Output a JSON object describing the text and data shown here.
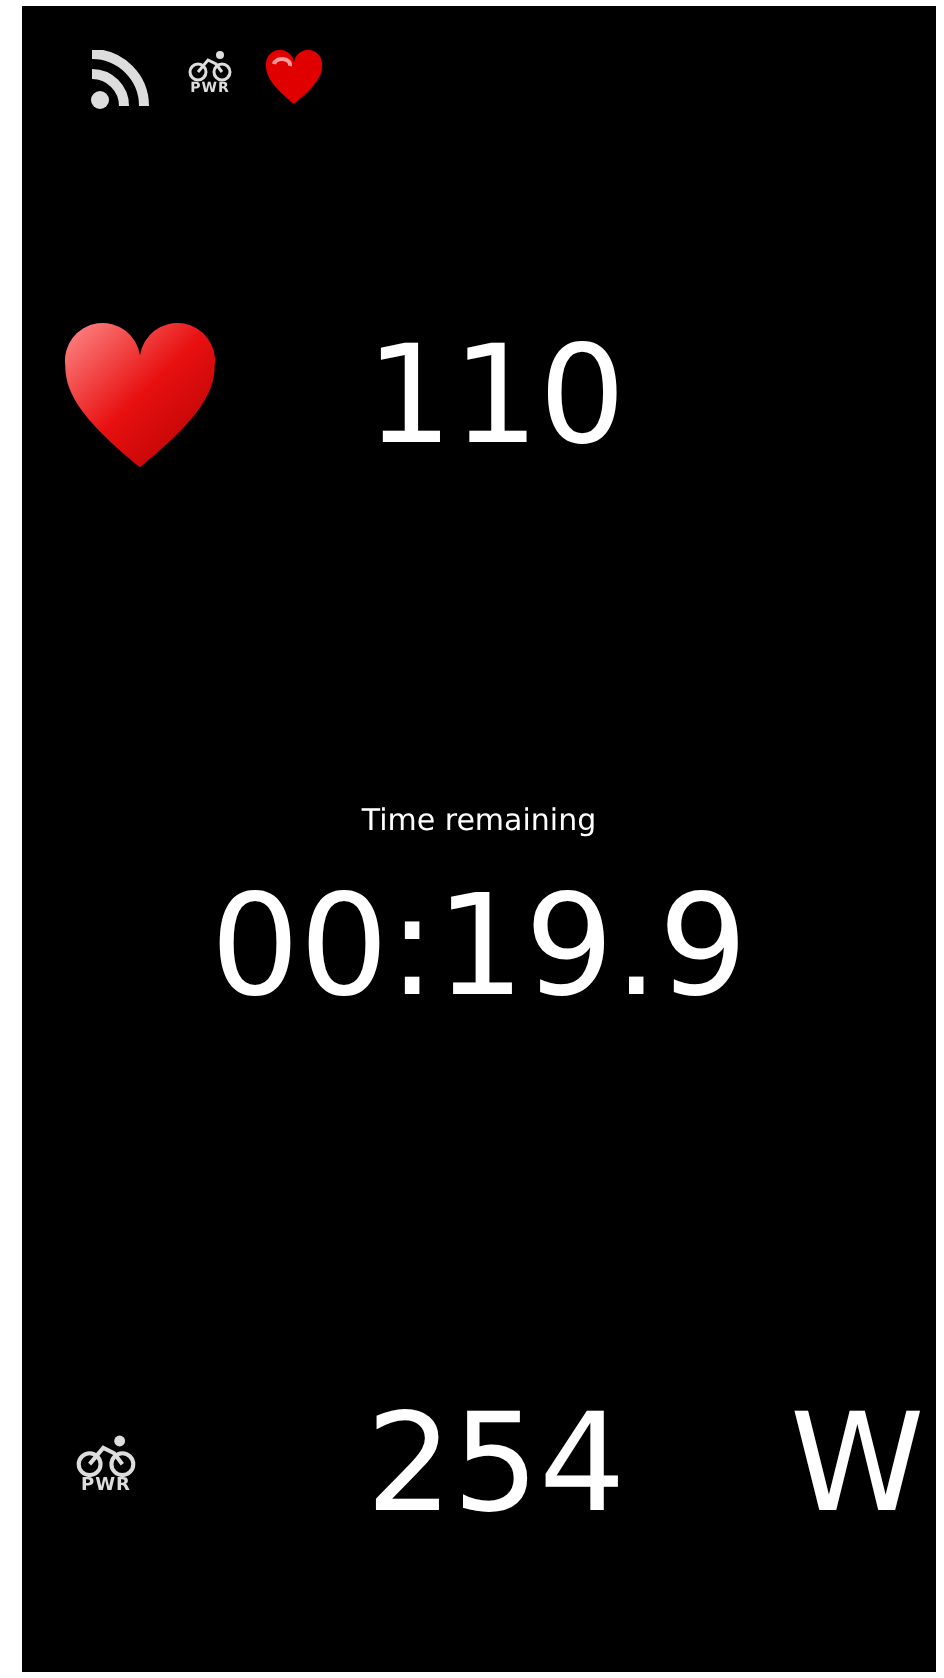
{
  "status_bar": {
    "power_label": "PWR"
  },
  "heart_rate": {
    "value": "110"
  },
  "timer": {
    "label": "Time remaining",
    "value": "00:19.9"
  },
  "power": {
    "label": "PWR",
    "value": "254",
    "unit": "W"
  }
}
